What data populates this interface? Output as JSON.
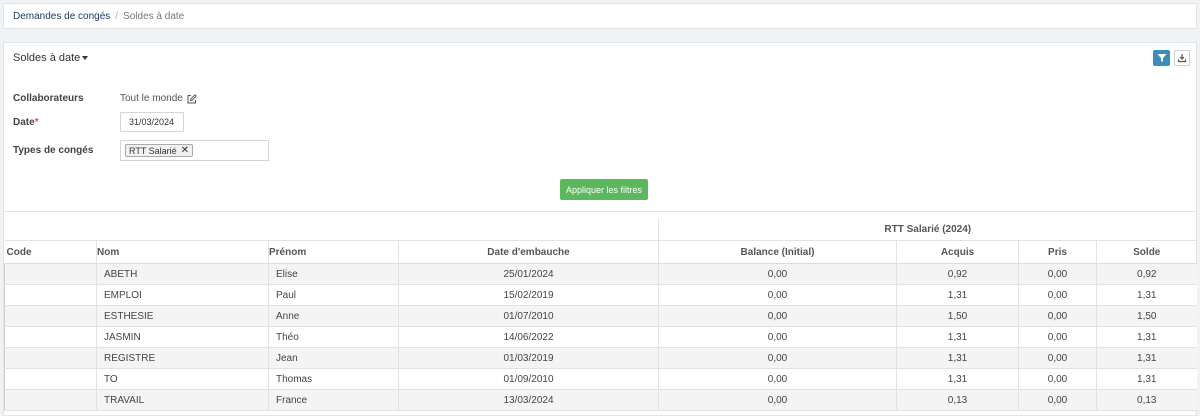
{
  "breadcrumb": {
    "parent": "Demandes de congés",
    "separator": "/",
    "current": "Soldes à date"
  },
  "panel": {
    "title": "Soldes à date",
    "filter_icon": "filter-icon",
    "download_icon": "download-icon"
  },
  "filters": {
    "collaborateurs_label": "Collaborateurs",
    "collaborateurs_value": "Tout le monde",
    "date_label": "Date",
    "date_required": "*",
    "date_value": "31/03/2024",
    "types_label": "Types de congés",
    "types_tag": "RTT Salarié",
    "apply_label": "Appliquer les filtres"
  },
  "table": {
    "group_header": "RTT Salarié (2024)",
    "columns": {
      "code": "Code",
      "nom": "Nom",
      "prenom": "Prénom",
      "embauche": "Date d'embauche",
      "balance": "Balance (Initial)",
      "acquis": "Acquis",
      "pris": "Pris",
      "solde": "Solde"
    },
    "rows": [
      {
        "code": "",
        "nom": "ABETH",
        "prenom": "Elise",
        "embauche": "25/01/2024",
        "balance": "0,00",
        "acquis": "0,92",
        "pris": "0,00",
        "solde": "0,92"
      },
      {
        "code": "",
        "nom": "EMPLOI",
        "prenom": "Paul",
        "embauche": "15/02/2019",
        "balance": "0,00",
        "acquis": "1,31",
        "pris": "0,00",
        "solde": "1,31"
      },
      {
        "code": "",
        "nom": "ESTHESIE",
        "prenom": "Anne",
        "embauche": "01/07/2010",
        "balance": "0,00",
        "acquis": "1,50",
        "pris": "0,00",
        "solde": "1,50"
      },
      {
        "code": "",
        "nom": "JASMIN",
        "prenom": "Théo",
        "embauche": "14/06/2022",
        "balance": "0,00",
        "acquis": "1,31",
        "pris": "0,00",
        "solde": "1,31"
      },
      {
        "code": "",
        "nom": "REGISTRE",
        "prenom": "Jean",
        "embauche": "01/03/2019",
        "balance": "0,00",
        "acquis": "1,31",
        "pris": "0,00",
        "solde": "1,31"
      },
      {
        "code": "",
        "nom": "TO",
        "prenom": "Thomas",
        "embauche": "01/09/2010",
        "balance": "0,00",
        "acquis": "1,31",
        "pris": "0,00",
        "solde": "1,31"
      },
      {
        "code": "",
        "nom": "TRAVAIL",
        "prenom": "France",
        "embauche": "13/03/2024",
        "balance": "0,00",
        "acquis": "0,13",
        "pris": "0,00",
        "solde": "0,13"
      }
    ]
  },
  "colors": {
    "link": "#1e3a63",
    "filter_button": "#3c8dbc",
    "apply_button": "#5cb85c",
    "required": "#d9534f"
  }
}
